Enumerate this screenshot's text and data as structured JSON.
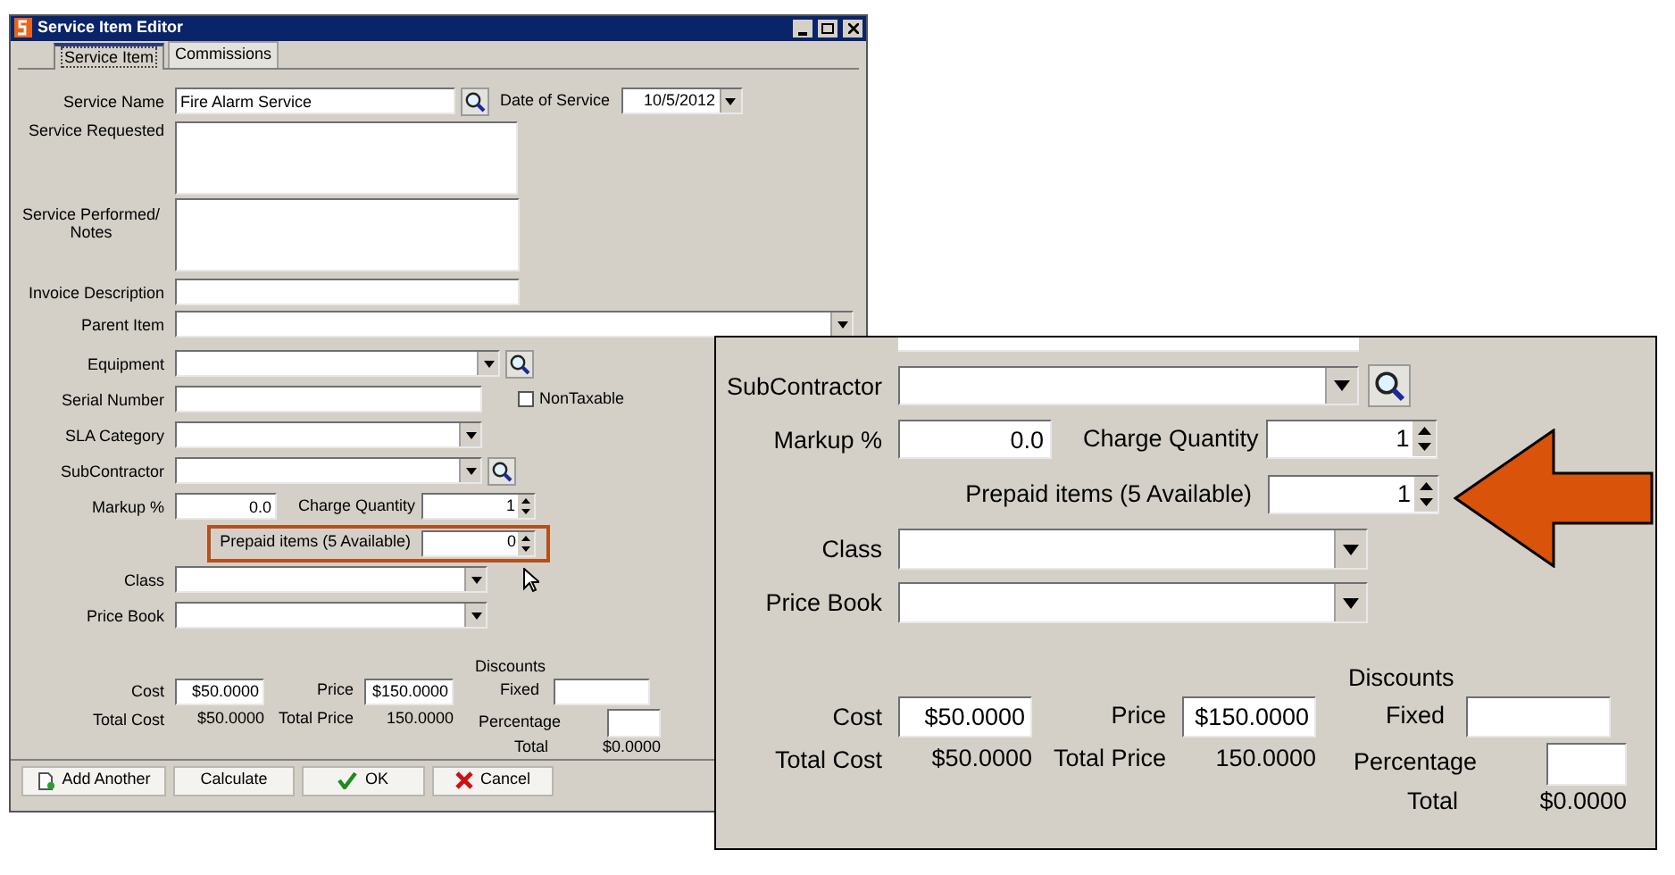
{
  "window": {
    "title": "Service Item Editor"
  },
  "tabs": [
    {
      "label": "Service Item",
      "selected": true
    },
    {
      "label": "Commissions",
      "selected": false
    }
  ],
  "form": {
    "service_name": {
      "label": "Service Name",
      "value": "Fire Alarm Service"
    },
    "date_of_service": {
      "label": "Date of Service",
      "value": "10/5/2012"
    },
    "service_requested": {
      "label": "Service Requested"
    },
    "service_performed": {
      "label": "Service Performed/ Notes"
    },
    "invoice_description": {
      "label": "Invoice Description"
    },
    "parent_item": {
      "label": "Parent Item"
    },
    "equipment": {
      "label": "Equipment"
    },
    "serial_number": {
      "label": "Serial Number"
    },
    "nontaxable": {
      "label": "NonTaxable",
      "checked": false
    },
    "sla_category": {
      "label": "SLA Category"
    },
    "pricing": {
      "subcontractor": {
        "label": "SubContractor"
      },
      "markup": {
        "label": "Markup %",
        "value": "0.0"
      },
      "charge_quantity": {
        "label": "Charge Quantity",
        "value": "1"
      },
      "prepaid_items": {
        "label": "Prepaid items (5 Available)",
        "value": "0",
        "highlighted": true
      },
      "class": {
        "label": "Class"
      },
      "price_book": {
        "label": "Price Book"
      },
      "discounts": {
        "label": "Discounts"
      },
      "cost": {
        "label": "Cost",
        "value": "$50.0000"
      },
      "price": {
        "label": "Price",
        "value": "$150.0000"
      },
      "fixed": {
        "label": "Fixed"
      },
      "total_cost": {
        "label": "Total Cost",
        "value": "$50.0000"
      },
      "total_price": {
        "label": "Total Price",
        "value": "150.0000"
      },
      "percentage": {
        "label": "Percentage"
      },
      "total": {
        "label": "Total",
        "value": "$0.0000"
      }
    }
  },
  "buttons": [
    {
      "label": "Add Another",
      "kind": "add"
    },
    {
      "label": "Calculate",
      "kind": "plain"
    },
    {
      "label": "OK",
      "kind": "confirm"
    },
    {
      "label": "Cancel",
      "kind": "cancel"
    }
  ],
  "zoom_inset": {
    "pricing": {
      "subcontractor": {
        "label": "SubContractor"
      },
      "markup": {
        "label": "Markup %",
        "value": "0.0"
      },
      "charge_quantity": {
        "label": "Charge Quantity",
        "value": "1"
      },
      "prepaid_items": {
        "label": "Prepaid items (5 Available)",
        "value": "1",
        "highlighted": false
      },
      "class": {
        "label": "Class"
      },
      "price_book": {
        "label": "Price Book"
      },
      "discounts": {
        "label": "Discounts"
      },
      "cost": {
        "label": "Cost",
        "value": "$50.0000"
      },
      "price": {
        "label": "Price",
        "value": "$150.0000"
      },
      "fixed": {
        "label": "Fixed"
      },
      "total_cost": {
        "label": "Total Cost",
        "value": "$50.0000"
      },
      "total_price": {
        "label": "Total Price",
        "value": "150.0000"
      },
      "percentage": {
        "label": "Percentage"
      },
      "total": {
        "label": "Total",
        "value": "$0.0000"
      }
    }
  }
}
